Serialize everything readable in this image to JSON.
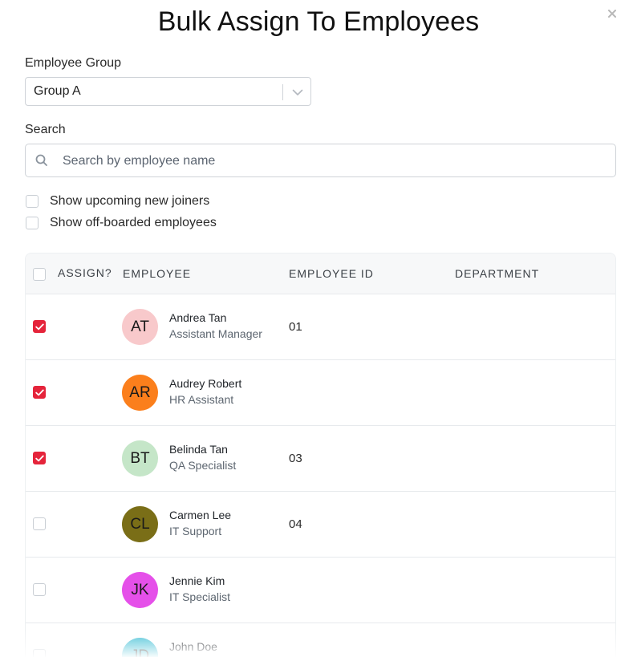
{
  "modal": {
    "title": "Bulk Assign To Employees"
  },
  "group_field": {
    "label": "Employee Group",
    "value": "Group A"
  },
  "search_field": {
    "label": "Search",
    "placeholder": "Search by employee name"
  },
  "options": [
    {
      "label": "Show upcoming new joiners",
      "checked": false
    },
    {
      "label": "Show off-boarded employees",
      "checked": false
    }
  ],
  "table": {
    "columns": [
      "ASSIGN?",
      "EMPLOYEE",
      "EMPLOYEE ID",
      "DEPARTMENT"
    ],
    "rows": [
      {
        "initials": "AT",
        "name": "Andrea Tan",
        "title": "Assistant Manager",
        "employee_id": "01",
        "department": "",
        "assigned": true,
        "avatar_color": "#f8c9cb"
      },
      {
        "initials": "AR",
        "name": "Audrey Robert",
        "title": "HR Assistant",
        "employee_id": "",
        "department": "",
        "assigned": true,
        "avatar_color": "#fb7f1c"
      },
      {
        "initials": "BT",
        "name": "Belinda Tan",
        "title": "QA Specialist",
        "employee_id": "03",
        "department": "",
        "assigned": true,
        "avatar_color": "#c5e6c8"
      },
      {
        "initials": "CL",
        "name": "Carmen Lee",
        "title": "IT Support",
        "employee_id": "04",
        "department": "",
        "assigned": false,
        "avatar_color": "#7a6e17"
      },
      {
        "initials": "JK",
        "name": "Jennie Kim",
        "title": "IT Specialist",
        "employee_id": "",
        "department": "",
        "assigned": false,
        "avatar_color": "#e550e9"
      },
      {
        "initials": "JD",
        "name": "John Doe",
        "title": "",
        "employee_id": "",
        "department": "",
        "assigned": false,
        "avatar_color": "#45c1d6"
      }
    ]
  },
  "colors": {
    "accent": "#e5243b"
  }
}
